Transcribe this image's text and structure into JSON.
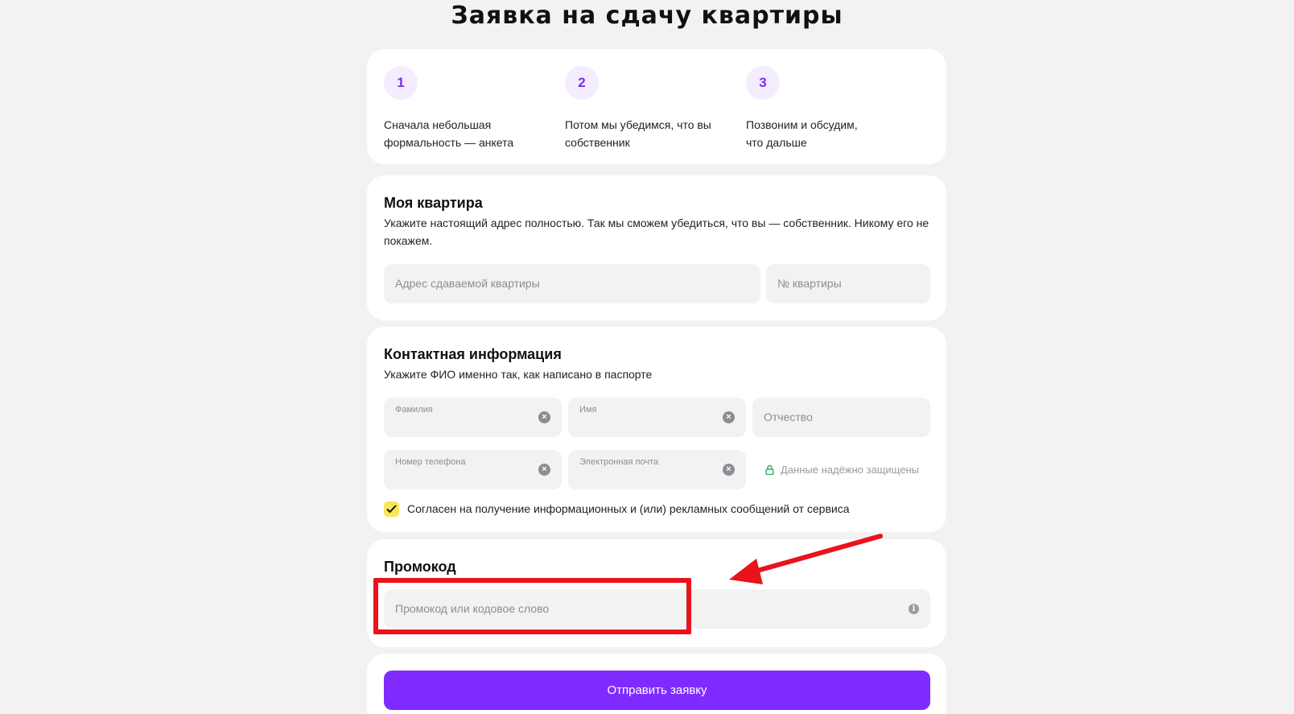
{
  "title": "Заявка на сдачу квартиры",
  "steps": [
    {
      "number": "1",
      "text": "Сначала небольшая\nформальность — анкета"
    },
    {
      "number": "2",
      "text": "Потом мы убедимся, что вы\nсобственник"
    },
    {
      "number": "3",
      "text": "Позвоним и обсудим,\nчто дальше"
    }
  ],
  "apartment": {
    "title": "Моя квартира",
    "description": "Укажите настоящий адрес полностью. Так мы сможем убедиться, что вы — собственник. Никому его не покажем.",
    "address_placeholder": "Адрес сдаваемой квартиры",
    "number_placeholder": "№ квартиры"
  },
  "contact": {
    "title": "Контактная информация",
    "description": "Укажите ФИО именно так, как написано в паспорте",
    "lastname_label": "Фамилия",
    "firstname_label": "Имя",
    "patronymic_placeholder": "Отчество",
    "phone_label": "Номер телефона",
    "email_label": "Электронная почта",
    "secure_note": "Данные надёжно защищены",
    "consent_text": "Согласен на получение информационных и (или) рекламных сообщений от сервиса",
    "consent_checked": true
  },
  "promo": {
    "title": "Промокод",
    "placeholder": "Промокод или кодовое слово"
  },
  "submit_label": "Отправить заявку",
  "colors": {
    "accent": "#7f2bff",
    "checkbox": "#fce45a",
    "annotation": "#e8131b"
  }
}
